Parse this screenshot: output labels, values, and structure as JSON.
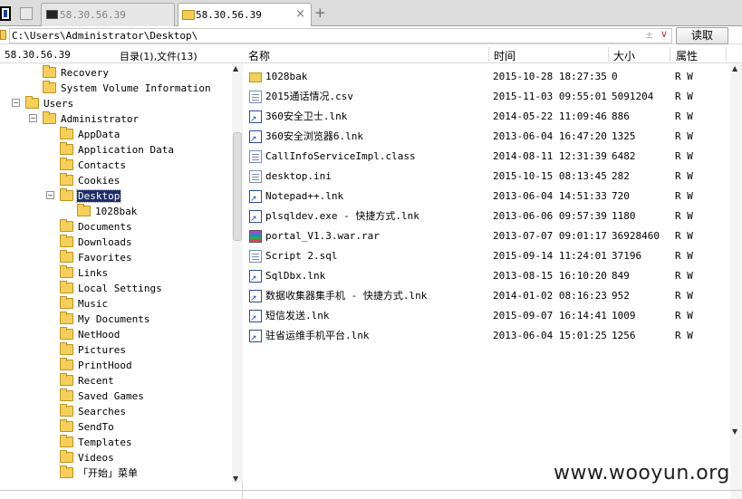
{
  "tabs": [
    {
      "label": "58.30.56.39",
      "active": false
    },
    {
      "label": "58.30.56.39",
      "active": true
    }
  ],
  "new_tab_symbol": "+",
  "tab_close_symbol": "×",
  "path": {
    "value": "C:\\Users\\Administrator\\Desktop\\",
    "clear_symbol": "±",
    "dropdown_symbol": "∨",
    "read_button": "读取"
  },
  "left": {
    "ip": "58.30.56.39",
    "count": "目录(1),文件(13)"
  },
  "tree": [
    {
      "label": "Recovery",
      "expander": ""
    },
    {
      "label": "System Volume Information",
      "expander": ""
    },
    {
      "label": "Users",
      "expander": "−"
    },
    {
      "label": "Administrator",
      "expander": "−"
    },
    {
      "label": "AppData",
      "expander": ""
    },
    {
      "label": "Application Data",
      "expander": ""
    },
    {
      "label": "Contacts",
      "expander": ""
    },
    {
      "label": "Cookies",
      "expander": ""
    },
    {
      "label": "Desktop",
      "expander": "−",
      "selected": true
    },
    {
      "label": "1028bak",
      "expander": ""
    },
    {
      "label": "Documents",
      "expander": ""
    },
    {
      "label": "Downloads",
      "expander": ""
    },
    {
      "label": "Favorites",
      "expander": ""
    },
    {
      "label": "Links",
      "expander": ""
    },
    {
      "label": "Local Settings",
      "expander": ""
    },
    {
      "label": "Music",
      "expander": ""
    },
    {
      "label": "My Documents",
      "expander": ""
    },
    {
      "label": "NetHood",
      "expander": ""
    },
    {
      "label": "Pictures",
      "expander": ""
    },
    {
      "label": "PrintHood",
      "expander": ""
    },
    {
      "label": "Recent",
      "expander": ""
    },
    {
      "label": "Saved Games",
      "expander": ""
    },
    {
      "label": "Searches",
      "expander": ""
    },
    {
      "label": "SendTo",
      "expander": ""
    },
    {
      "label": "Templates",
      "expander": ""
    },
    {
      "label": "Videos",
      "expander": ""
    },
    {
      "label": "「开始」菜单",
      "expander": ""
    }
  ],
  "columns": {
    "name": "名称",
    "time": "时间",
    "size": "大小",
    "attr": "属性"
  },
  "files": [
    {
      "name": "1028bak",
      "time": "2015-10-28 18:27:35",
      "size": "0",
      "attr": "R W",
      "icon": "folder-icon"
    },
    {
      "name": "2015通话情况.csv",
      "time": "2015-11-03 09:55:01",
      "size": "5091204",
      "attr": "R W",
      "icon": "doc-icon"
    },
    {
      "name": "360安全卫士.lnk",
      "time": "2014-05-22 11:09:46",
      "size": "886",
      "attr": "R W",
      "icon": "shortcut-icon"
    },
    {
      "name": "360安全浏览器6.lnk",
      "time": "2013-06-04 16:47:20",
      "size": "1325",
      "attr": "R W",
      "icon": "shortcut-icon"
    },
    {
      "name": "CallInfoServiceImpl.class",
      "time": "2014-08-11 12:31:39",
      "size": "6482",
      "attr": "R W",
      "icon": "doc-icon"
    },
    {
      "name": "desktop.ini",
      "time": "2015-10-15 08:13:45",
      "size": "282",
      "attr": "R W",
      "icon": "doc-icon"
    },
    {
      "name": "Notepad++.lnk",
      "time": "2013-06-04 14:51:33",
      "size": "720",
      "attr": "R W",
      "icon": "shortcut-icon"
    },
    {
      "name": "plsqldev.exe - 快捷方式.lnk",
      "time": "2013-06-06 09:57:39",
      "size": "1180",
      "attr": "R W",
      "icon": "shortcut-icon"
    },
    {
      "name": "portal_V1.3.war.rar",
      "time": "2013-07-07 09:01:17",
      "size": "36928460",
      "attr": "R W",
      "icon": "rar-icon"
    },
    {
      "name": "Script 2.sql",
      "time": "2015-09-14 11:24:01",
      "size": "37196",
      "attr": "R W",
      "icon": "doc-icon"
    },
    {
      "name": "SqlDbx.lnk",
      "time": "2013-08-15 16:10:20",
      "size": "849",
      "attr": "R W",
      "icon": "shortcut-icon"
    },
    {
      "name": "数据收集器集手机 - 快捷方式.lnk",
      "time": "2014-01-02 08:16:23",
      "size": "952",
      "attr": "R W",
      "icon": "shortcut-icon"
    },
    {
      "name": "短信发送.lnk",
      "time": "2015-09-07 16:14:41",
      "size": "1009",
      "attr": "R W",
      "icon": "shortcut-icon"
    },
    {
      "name": "驻省运维手机平台.lnk",
      "time": "2013-06-04 15:01:25",
      "size": "1256",
      "attr": "R W",
      "icon": "shortcut-icon"
    }
  ],
  "scroll_arrows": {
    "up": "▲",
    "down": "▼"
  },
  "watermark": "www.wooyun.org"
}
